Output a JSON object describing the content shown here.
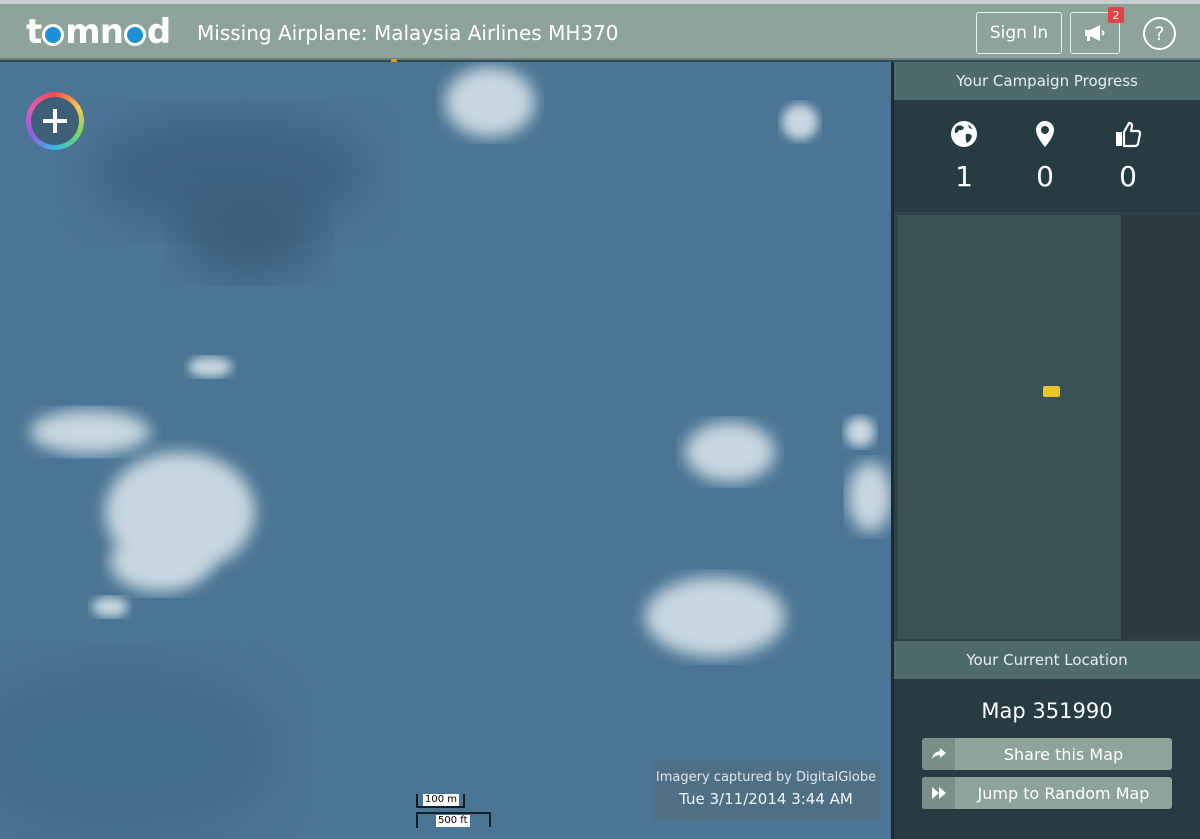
{
  "header": {
    "logo_text": "tomnod",
    "title": "Missing Airplane: Malaysia Airlines MH370",
    "sign_in": "Sign In",
    "notification_count": "2",
    "help": "?"
  },
  "map": {
    "attribution_line1": "Imagery captured by DigitalGlobe",
    "attribution_line2": "Tue 3/11/2014 3:44 AM",
    "scale_metric": "100 m",
    "scale_imperial": "500 ft"
  },
  "sidebar": {
    "progress_title": "Your Campaign Progress",
    "stats": [
      {
        "icon": "globe-icon",
        "value": "1"
      },
      {
        "icon": "map-pin-icon",
        "value": "0"
      },
      {
        "icon": "thumbs-up-icon",
        "value": "0"
      }
    ],
    "location_title": "Your Current Location",
    "map_label": "Map 351990",
    "share_button": "Share this Map",
    "jump_button": "Jump to Random Map"
  },
  "colors": {
    "header_bg": "#8ea39a",
    "ocean": "#4b7594",
    "marker": "#e7c625",
    "badge": "#e04545"
  }
}
